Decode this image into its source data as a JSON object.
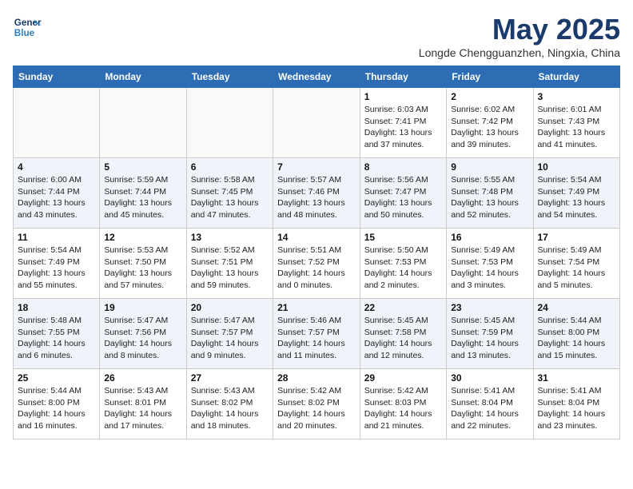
{
  "header": {
    "logo_line1": "General",
    "logo_line2": "Blue",
    "month": "May 2025",
    "location": "Longde Chengguanzhen, Ningxia, China"
  },
  "days_of_week": [
    "Sunday",
    "Monday",
    "Tuesday",
    "Wednesday",
    "Thursday",
    "Friday",
    "Saturday"
  ],
  "weeks": [
    [
      {
        "day": "",
        "info": ""
      },
      {
        "day": "",
        "info": ""
      },
      {
        "day": "",
        "info": ""
      },
      {
        "day": "",
        "info": ""
      },
      {
        "day": "1",
        "info": "Sunrise: 6:03 AM\nSunset: 7:41 PM\nDaylight: 13 hours\nand 37 minutes."
      },
      {
        "day": "2",
        "info": "Sunrise: 6:02 AM\nSunset: 7:42 PM\nDaylight: 13 hours\nand 39 minutes."
      },
      {
        "day": "3",
        "info": "Sunrise: 6:01 AM\nSunset: 7:43 PM\nDaylight: 13 hours\nand 41 minutes."
      }
    ],
    [
      {
        "day": "4",
        "info": "Sunrise: 6:00 AM\nSunset: 7:44 PM\nDaylight: 13 hours\nand 43 minutes."
      },
      {
        "day": "5",
        "info": "Sunrise: 5:59 AM\nSunset: 7:44 PM\nDaylight: 13 hours\nand 45 minutes."
      },
      {
        "day": "6",
        "info": "Sunrise: 5:58 AM\nSunset: 7:45 PM\nDaylight: 13 hours\nand 47 minutes."
      },
      {
        "day": "7",
        "info": "Sunrise: 5:57 AM\nSunset: 7:46 PM\nDaylight: 13 hours\nand 48 minutes."
      },
      {
        "day": "8",
        "info": "Sunrise: 5:56 AM\nSunset: 7:47 PM\nDaylight: 13 hours\nand 50 minutes."
      },
      {
        "day": "9",
        "info": "Sunrise: 5:55 AM\nSunset: 7:48 PM\nDaylight: 13 hours\nand 52 minutes."
      },
      {
        "day": "10",
        "info": "Sunrise: 5:54 AM\nSunset: 7:49 PM\nDaylight: 13 hours\nand 54 minutes."
      }
    ],
    [
      {
        "day": "11",
        "info": "Sunrise: 5:54 AM\nSunset: 7:49 PM\nDaylight: 13 hours\nand 55 minutes."
      },
      {
        "day": "12",
        "info": "Sunrise: 5:53 AM\nSunset: 7:50 PM\nDaylight: 13 hours\nand 57 minutes."
      },
      {
        "day": "13",
        "info": "Sunrise: 5:52 AM\nSunset: 7:51 PM\nDaylight: 13 hours\nand 59 minutes."
      },
      {
        "day": "14",
        "info": "Sunrise: 5:51 AM\nSunset: 7:52 PM\nDaylight: 14 hours\nand 0 minutes."
      },
      {
        "day": "15",
        "info": "Sunrise: 5:50 AM\nSunset: 7:53 PM\nDaylight: 14 hours\nand 2 minutes."
      },
      {
        "day": "16",
        "info": "Sunrise: 5:49 AM\nSunset: 7:53 PM\nDaylight: 14 hours\nand 3 minutes."
      },
      {
        "day": "17",
        "info": "Sunrise: 5:49 AM\nSunset: 7:54 PM\nDaylight: 14 hours\nand 5 minutes."
      }
    ],
    [
      {
        "day": "18",
        "info": "Sunrise: 5:48 AM\nSunset: 7:55 PM\nDaylight: 14 hours\nand 6 minutes."
      },
      {
        "day": "19",
        "info": "Sunrise: 5:47 AM\nSunset: 7:56 PM\nDaylight: 14 hours\nand 8 minutes."
      },
      {
        "day": "20",
        "info": "Sunrise: 5:47 AM\nSunset: 7:57 PM\nDaylight: 14 hours\nand 9 minutes."
      },
      {
        "day": "21",
        "info": "Sunrise: 5:46 AM\nSunset: 7:57 PM\nDaylight: 14 hours\nand 11 minutes."
      },
      {
        "day": "22",
        "info": "Sunrise: 5:45 AM\nSunset: 7:58 PM\nDaylight: 14 hours\nand 12 minutes."
      },
      {
        "day": "23",
        "info": "Sunrise: 5:45 AM\nSunset: 7:59 PM\nDaylight: 14 hours\nand 13 minutes."
      },
      {
        "day": "24",
        "info": "Sunrise: 5:44 AM\nSunset: 8:00 PM\nDaylight: 14 hours\nand 15 minutes."
      }
    ],
    [
      {
        "day": "25",
        "info": "Sunrise: 5:44 AM\nSunset: 8:00 PM\nDaylight: 14 hours\nand 16 minutes."
      },
      {
        "day": "26",
        "info": "Sunrise: 5:43 AM\nSunset: 8:01 PM\nDaylight: 14 hours\nand 17 minutes."
      },
      {
        "day": "27",
        "info": "Sunrise: 5:43 AM\nSunset: 8:02 PM\nDaylight: 14 hours\nand 18 minutes."
      },
      {
        "day": "28",
        "info": "Sunrise: 5:42 AM\nSunset: 8:02 PM\nDaylight: 14 hours\nand 20 minutes."
      },
      {
        "day": "29",
        "info": "Sunrise: 5:42 AM\nSunset: 8:03 PM\nDaylight: 14 hours\nand 21 minutes."
      },
      {
        "day": "30",
        "info": "Sunrise: 5:41 AM\nSunset: 8:04 PM\nDaylight: 14 hours\nand 22 minutes."
      },
      {
        "day": "31",
        "info": "Sunrise: 5:41 AM\nSunset: 8:04 PM\nDaylight: 14 hours\nand 23 minutes."
      }
    ]
  ]
}
